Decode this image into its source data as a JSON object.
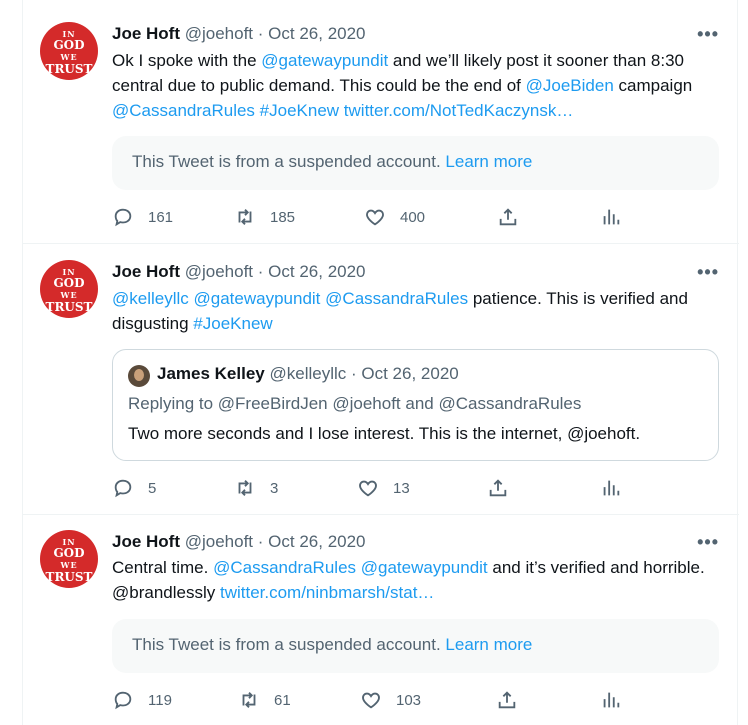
{
  "tweets": [
    {
      "author": {
        "name": "Joe Hoft",
        "handle": "@joehoft",
        "date": "· Oct 26, 2020"
      },
      "avatar": {
        "l1": "IN",
        "l2": "GOD",
        "l3": "WE",
        "l4": "TRUST"
      },
      "more": "•••",
      "text": {
        "p1": "Ok I spoke with the ",
        "m1": "@gatewaypundit",
        "p2": " and we’ll likely post it sooner than 8:30 central due to public demand. This could be the end of ",
        "m2": "@JoeBiden",
        "p3": " campaign ",
        "m3": "@CassandraRules",
        "p4": " ",
        "m4": "#JoeKnew",
        "p5": " ",
        "m5": "twitter.com/NotTedKaczynsk…"
      },
      "suspended": {
        "text": "This Tweet is from a suspended account. ",
        "link": "Learn more"
      },
      "stats": {
        "replies": "161",
        "retweets": "185",
        "likes": "400"
      }
    },
    {
      "author": {
        "name": "Joe Hoft",
        "handle": "@joehoft",
        "date": "· Oct 26, 2020"
      },
      "avatar": {
        "l1": "IN",
        "l2": "GOD",
        "l3": "WE",
        "l4": "TRUST"
      },
      "more": "•••",
      "text": {
        "m1": "@kelleyllc",
        "p1": " ",
        "m2": "@gatewaypundit",
        "p2": " ",
        "m3": "@CassandraRules",
        "p3": " patience. This is verified and disgusting ",
        "m4": "#JoeKnew"
      },
      "quote": {
        "name": "James Kelley",
        "handle": "@kelleyllc",
        "date": "· Oct 26, 2020",
        "reply": "Replying to @FreeBirdJen @joehoft and @CassandraRules",
        "text": "Two more seconds and I lose interest. This is the internet, @joehoft."
      },
      "stats": {
        "replies": "5",
        "retweets": "3",
        "likes": "13"
      }
    },
    {
      "author": {
        "name": "Joe Hoft",
        "handle": "@joehoft",
        "date": "· Oct 26, 2020"
      },
      "avatar": {
        "l1": "IN",
        "l2": "GOD",
        "l3": "WE",
        "l4": "TRUST"
      },
      "more": "•••",
      "text": {
        "p1": "Central time. ",
        "m1": "@CassandraRules",
        "p2": " ",
        "m2": "@gatewaypundit",
        "p3": " and it’s verified and horrible. @brandlessly ",
        "m3": "twitter.com/ninbmarsh/stat…"
      },
      "suspended": {
        "text": "This Tweet is from a suspended account. ",
        "link": "Learn more"
      },
      "stats": {
        "replies": "119",
        "retweets": "61",
        "likes": "103"
      }
    }
  ],
  "colors": {
    "link": "#1d9bf0",
    "muted": "#536471",
    "avatar_bg": "#d42a2a"
  },
  "icons": [
    "reply-icon",
    "retweet-icon",
    "like-icon",
    "share-icon",
    "analytics-icon",
    "more-icon"
  ]
}
